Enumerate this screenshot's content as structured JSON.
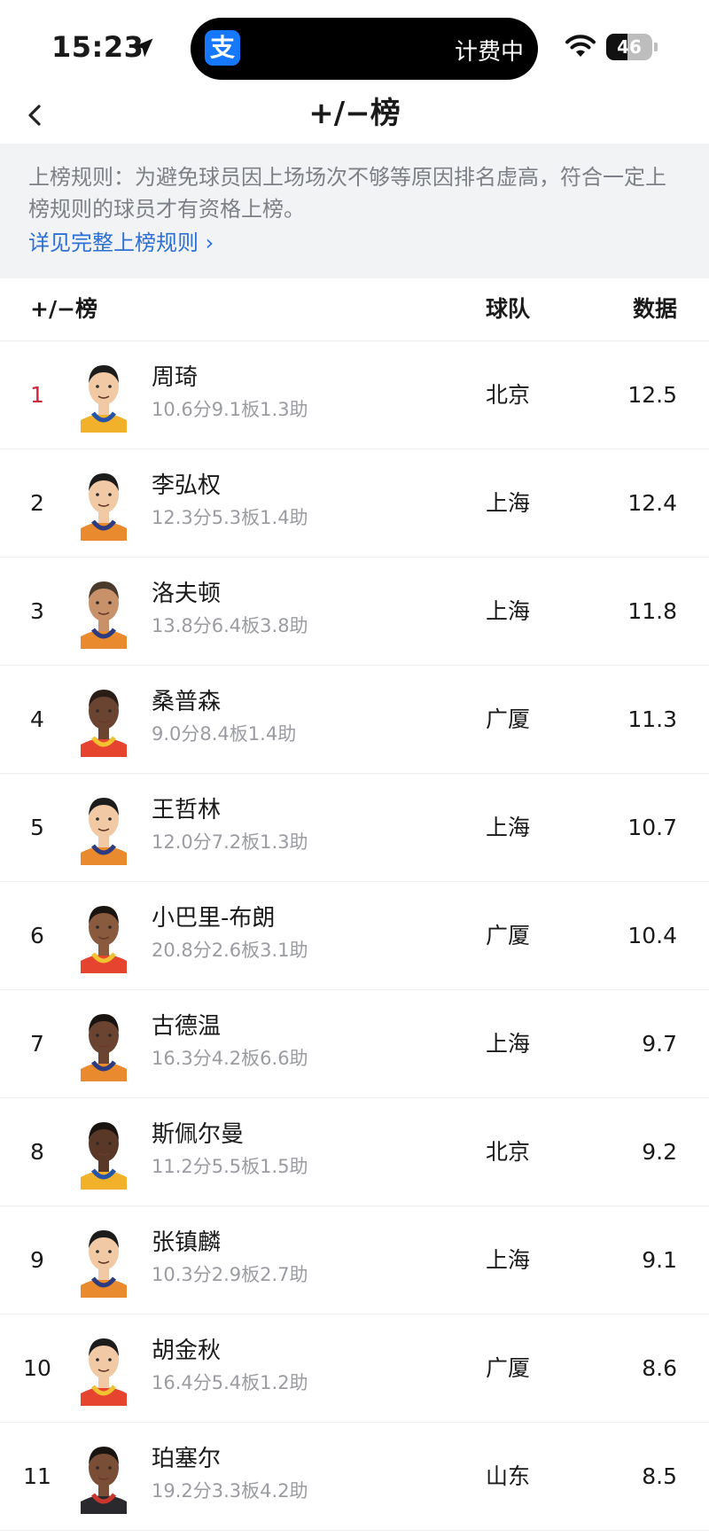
{
  "status_bar": {
    "time": "15:23",
    "island_app_icon": "支",
    "island_text": "计费中",
    "battery_level": "46",
    "battery_fraction": 0.46
  },
  "nav": {
    "title": "+/−榜",
    "back_icon": "chevron-left-icon"
  },
  "notice": {
    "rule_text": "上榜规则：为避免球员因上场场次不够等原因排名虚高，符合一定上榜规则的球员才有资格上榜。",
    "link_text": "详见完整上榜规则 ›"
  },
  "table": {
    "headers": {
      "rank_col": "+/−榜",
      "team_col": "球队",
      "value_col": "数据"
    },
    "rows": [
      {
        "rank": "1",
        "name": "周琦",
        "stats": "10.6分9.1板1.3助",
        "team": "北京",
        "value": "12.5",
        "jersey": "#f2b12a",
        "trim": "#2554a8",
        "skin": "#f1c9a5",
        "hair": "#1c1c1c"
      },
      {
        "rank": "2",
        "name": "李弘权",
        "stats": "12.3分5.3板1.4助",
        "team": "上海",
        "value": "12.4",
        "jersey": "#e98a2e",
        "trim": "#2d3c80",
        "skin": "#f1c9a5",
        "hair": "#1c1c1c"
      },
      {
        "rank": "3",
        "name": "洛夫顿",
        "stats": "13.8分6.4板3.8助",
        "team": "上海",
        "value": "11.8",
        "jersey": "#e98a2e",
        "trim": "#2d3c80",
        "skin": "#c8916a",
        "hair": "#4a3a2c"
      },
      {
        "rank": "4",
        "name": "桑普森",
        "stats": "9.0分8.4板1.4助",
        "team": "广厦",
        "value": "11.3",
        "jersey": "#e7442f",
        "trim": "#f2c230",
        "skin": "#6b4431",
        "hair": "#2a1d16"
      },
      {
        "rank": "5",
        "name": "王哲林",
        "stats": "12.0分7.2板1.3助",
        "team": "上海",
        "value": "10.7",
        "jersey": "#e98a2e",
        "trim": "#2d3c80",
        "skin": "#f1c9a5",
        "hair": "#1c1c1c"
      },
      {
        "rank": "6",
        "name": "小巴里-布朗",
        "stats": "20.8分2.6板3.1助",
        "team": "广厦",
        "value": "10.4",
        "jersey": "#e7442f",
        "trim": "#f2c230",
        "skin": "#8a5a3e",
        "hair": "#1a1410"
      },
      {
        "rank": "7",
        "name": "古德温",
        "stats": "16.3分4.2板6.6助",
        "team": "上海",
        "value": "9.7",
        "jersey": "#e98a2e",
        "trim": "#2d3c80",
        "skin": "#6b4431",
        "hair": "#1a1410"
      },
      {
        "rank": "8",
        "name": "斯佩尔曼",
        "stats": "11.2分5.5板1.5助",
        "team": "北京",
        "value": "9.2",
        "jersey": "#f2b12a",
        "trim": "#2554a8",
        "skin": "#5a3828",
        "hair": "#1a1410"
      },
      {
        "rank": "9",
        "name": "张镇麟",
        "stats": "10.3分2.9板2.7助",
        "team": "上海",
        "value": "9.1",
        "jersey": "#e98a2e",
        "trim": "#2d3c80",
        "skin": "#f1c9a5",
        "hair": "#1c1c1c"
      },
      {
        "rank": "10",
        "name": "胡金秋",
        "stats": "16.4分5.4板1.2助",
        "team": "广厦",
        "value": "8.6",
        "jersey": "#e7442f",
        "trim": "#f2c230",
        "skin": "#f1c9a5",
        "hair": "#1c1c1c"
      },
      {
        "rank": "11",
        "name": "珀塞尔",
        "stats": "19.2分3.3板4.2助",
        "team": "山东",
        "value": "8.5",
        "jersey": "#2a2a2e",
        "trim": "#c9372c",
        "skin": "#7a4e36",
        "hair": "#1a1410"
      }
    ]
  },
  "colors": {
    "rank_highlight": "#d0263c",
    "link_blue": "#2c6fd6",
    "notice_bg": "#f2f3f5",
    "muted_text": "#9a9ca2"
  }
}
